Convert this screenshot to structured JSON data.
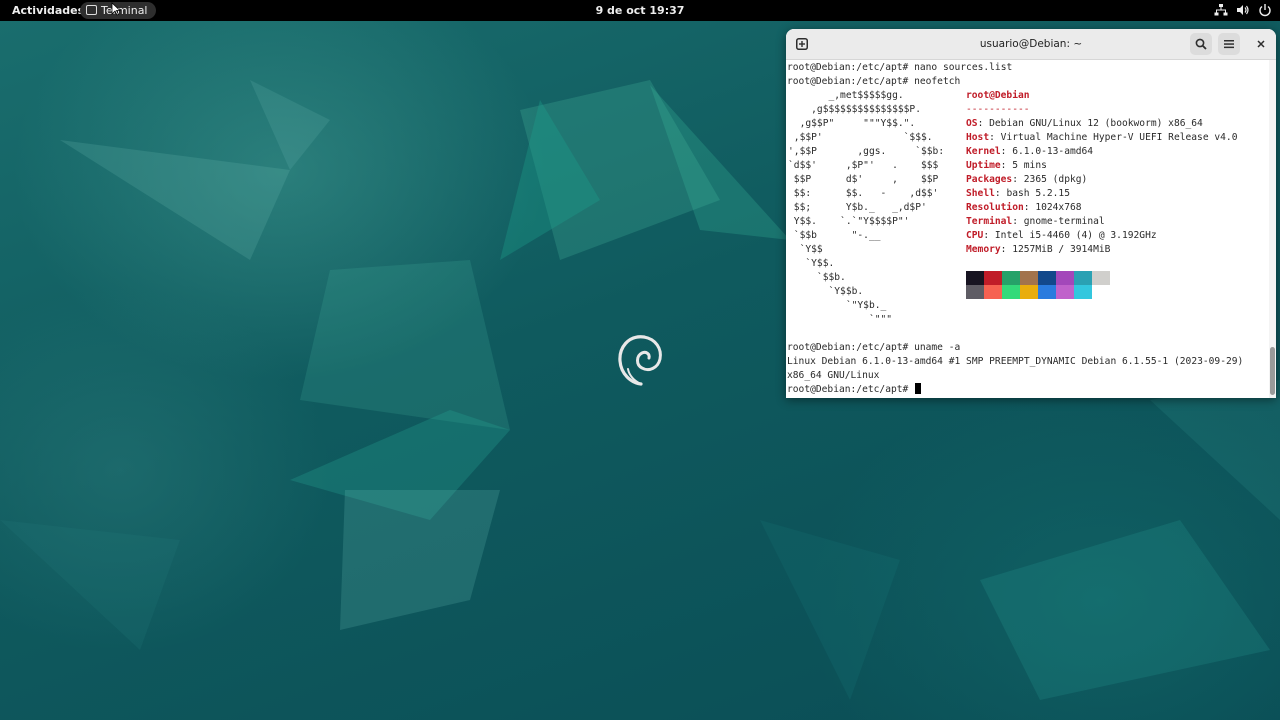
{
  "topbar": {
    "activities": "Actividades",
    "app_name": "Terminal",
    "clock": "9 de oct  19:37",
    "tray_icons": [
      "network-icon",
      "volume-icon",
      "power-icon"
    ]
  },
  "terminal": {
    "title": "usuario@Debian: ~",
    "lines_before": [
      "root@Debian:/etc/apt# nano sources.list",
      "root@Debian:/etc/apt# neofetch"
    ],
    "neofetch": {
      "ascii_art": [
        "       _,met$$$$$gg.",
        "    ,g$$$$$$$$$$$$$$$P.",
        "  ,g$$P\"     \"\"\"Y$$.\".",
        " ,$$P'              `$$$.",
        "',$$P       ,ggs.     `$$b:",
        "`d$$'     ,$P\"'   .    $$$",
        " $$P      d$'     ,    $$P",
        " $$:      $$.   -    ,d$$'",
        " $$;      Y$b._   _,d$P'",
        " Y$$.    `.`\"Y$$$$P\"'",
        " `$$b      \"-.__",
        "  `Y$$",
        "   `Y$$.",
        "     `$$b.",
        "       `Y$$b.",
        "          `\"Y$b._",
        "              `\"\"\""
      ],
      "user_host": "root@Debian",
      "separator": "-----------",
      "info": [
        {
          "key": "OS",
          "value": "Debian GNU/Linux 12 (bookworm) x86_64"
        },
        {
          "key": "Host",
          "value": "Virtual Machine Hyper-V UEFI Release v4.0"
        },
        {
          "key": "Kernel",
          "value": "6.1.0-13-amd64"
        },
        {
          "key": "Uptime",
          "value": "5 mins"
        },
        {
          "key": "Packages",
          "value": "2365 (dpkg)"
        },
        {
          "key": "Shell",
          "value": "bash 5.2.15"
        },
        {
          "key": "Resolution",
          "value": "1024x768"
        },
        {
          "key": "Terminal",
          "value": "gnome-terminal"
        },
        {
          "key": "CPU",
          "value": "Intel i5-4460 (4) @ 3.192GHz"
        },
        {
          "key": "Memory",
          "value": "1257MiB / 3914MiB"
        }
      ],
      "palette_row1": [
        "#171421",
        "#c01c28",
        "#26a269",
        "#a2734c",
        "#12488b",
        "#a347ba",
        "#2aa1b3",
        "#d0cfcc"
      ],
      "palette_row2": [
        "#5e5c64",
        "#f66151",
        "#33da7a",
        "#e9ad0c",
        "#2a7bde",
        "#c061cb",
        "#33c7de",
        "#ffffff"
      ]
    },
    "lines_after": [
      "root@Debian:/etc/apt# uname -a",
      "Linux Debian 6.1.0-13-amd64 #1 SMP PREEMPT_DYNAMIC Debian 6.1.55-1 (2023-09-29)",
      "x86_64 GNU/Linux",
      "root@Debian:/etc/apt# "
    ]
  }
}
